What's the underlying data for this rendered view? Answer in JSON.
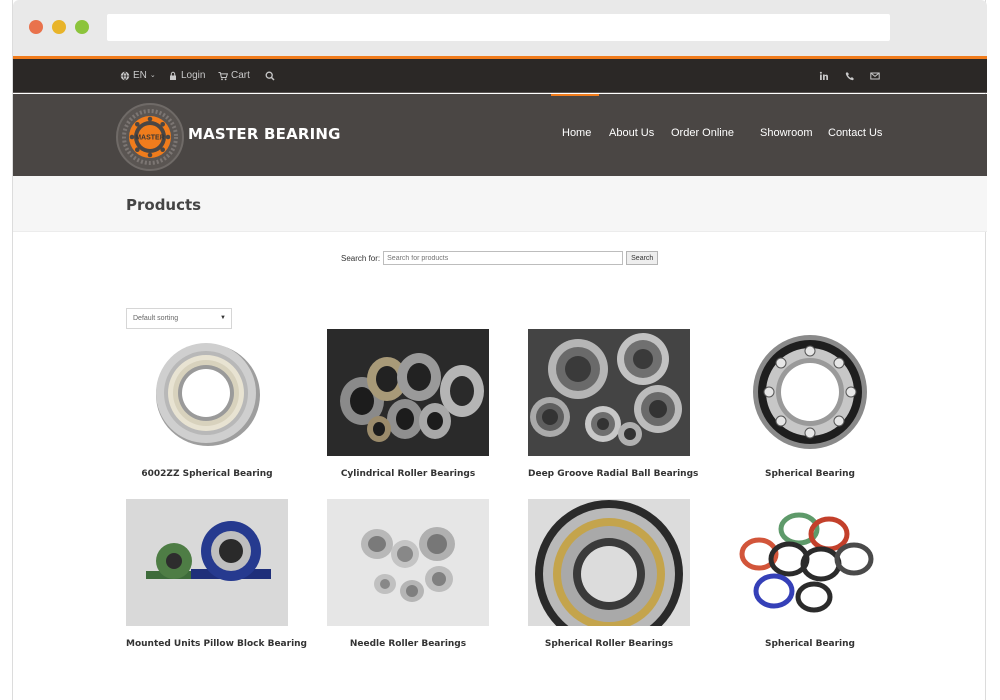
{
  "topbar": {
    "language": "EN",
    "login": "Login",
    "cart": "Cart"
  },
  "brand": {
    "name": "MASTER BEARING",
    "logo_text": "MASTER"
  },
  "nav": {
    "items": [
      "Home",
      "About Us",
      "Order Online",
      "Showroom",
      "Contact Us"
    ],
    "active": "Home"
  },
  "page": {
    "title": "Products"
  },
  "search": {
    "label": "Search for:",
    "placeholder": "Search for products",
    "button": "Search"
  },
  "sorting": {
    "selected": "Default sorting"
  },
  "products": [
    {
      "name": "6002ZZ Spherical Bearing"
    },
    {
      "name": "Cylindrical Roller Bearings"
    },
    {
      "name": "Deep Groove Radial Ball Bearings"
    },
    {
      "name": "Spherical Bearing"
    },
    {
      "name": "Mounted Units Pillow Block Bearing"
    },
    {
      "name": "Needle Roller Bearings"
    },
    {
      "name": "Spherical Roller Bearings"
    },
    {
      "name": "Spherical Bearing"
    }
  ],
  "colors": {
    "accent": "#f07c1c",
    "topbar": "#2b2826",
    "mainnav": "#4a4644"
  }
}
